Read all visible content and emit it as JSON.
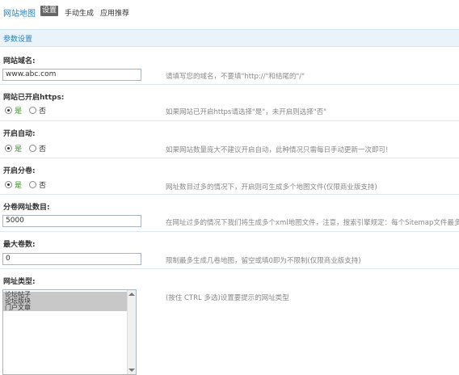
{
  "header": {
    "title": "网站地图",
    "tabs": [
      {
        "label": "设置",
        "active": true
      },
      {
        "label": "手动生成",
        "active": false
      },
      {
        "label": "应用推荐",
        "active": false
      }
    ]
  },
  "section_title": "参数设置",
  "fields": {
    "domain": {
      "label": "网站域名:",
      "value": "www.abc.com",
      "hint": "请填写您的域名，不要填\"http://\"和结尾的\"/\""
    },
    "https": {
      "label": "网站已开启https:",
      "yes": "是",
      "no": "否",
      "selected": "yes",
      "hint": "如果网站已开启https请选择\"是\"，未开启则选择\"否\""
    },
    "auto": {
      "label": "开启自动:",
      "yes": "是",
      "no": "否",
      "selected": "yes",
      "hint": "如果网站数量庞大不建议开启自动，此种情况只需每日手动更新一次即可!"
    },
    "split": {
      "label": "开启分卷:",
      "yes": "是",
      "no": "否",
      "selected": "yes",
      "hint": "网址数目过多的情况下，开启则可生成多个地图文件(仅限商业版支持)"
    },
    "split_count": {
      "label": "分卷网址数目:",
      "value": "5000",
      "hint": "在网址过多的情况下我们将生成多个xml地图文件，注意，搜索引擎规定：每个Sitemap文件最多可包含"
    },
    "max_volumes": {
      "label": "最大卷数:",
      "value": "0",
      "hint": "限制最多生成几卷地图，留空或填0即为不限制(仅限商业版支持)"
    },
    "url_types": {
      "label": "网址类型:",
      "options": [
        "论坛帖子",
        "论坛版块",
        "门户文章"
      ],
      "hint": "(按住 CTRL 多选)设置要提示的网址类型"
    }
  },
  "colors": {
    "accent": "#2a7fb8",
    "section_bg": "#eaf3f9",
    "yes_green": "#3c8c2f"
  }
}
